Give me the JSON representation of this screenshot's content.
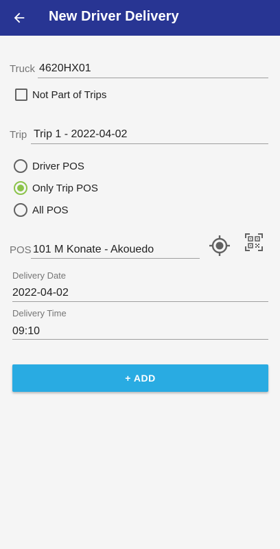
{
  "app_bar": {
    "title": "New Driver Delivery",
    "background": "#283593",
    "back_icon": "arrow-left-icon"
  },
  "form": {
    "truck": {
      "label": "Truck",
      "value": "4620HX01"
    },
    "not_part_of_trips": {
      "label": "Not Part of Trips",
      "checked": false
    },
    "trip": {
      "label": "Trip",
      "value": "Trip 1 - 2022-04-02"
    },
    "pos_filter": {
      "options": [
        {
          "label": "Driver POS",
          "selected": false
        },
        {
          "label": "Only Trip POS",
          "selected": true
        },
        {
          "label": "All POS",
          "selected": false
        }
      ],
      "accent": "#8bc34a"
    },
    "pos": {
      "label": "POS",
      "value": "101 M Konate - Akouedo",
      "locate_icon": "gps-target-icon",
      "scan_icon": "qr-code-scan-icon"
    },
    "delivery_date": {
      "label": "Delivery Date",
      "value": "2022-04-02"
    },
    "delivery_time": {
      "label": "Delivery Time",
      "value": "09:10"
    }
  },
  "actions": {
    "add_label": "+ ADD",
    "add_color": "#29abe2"
  }
}
